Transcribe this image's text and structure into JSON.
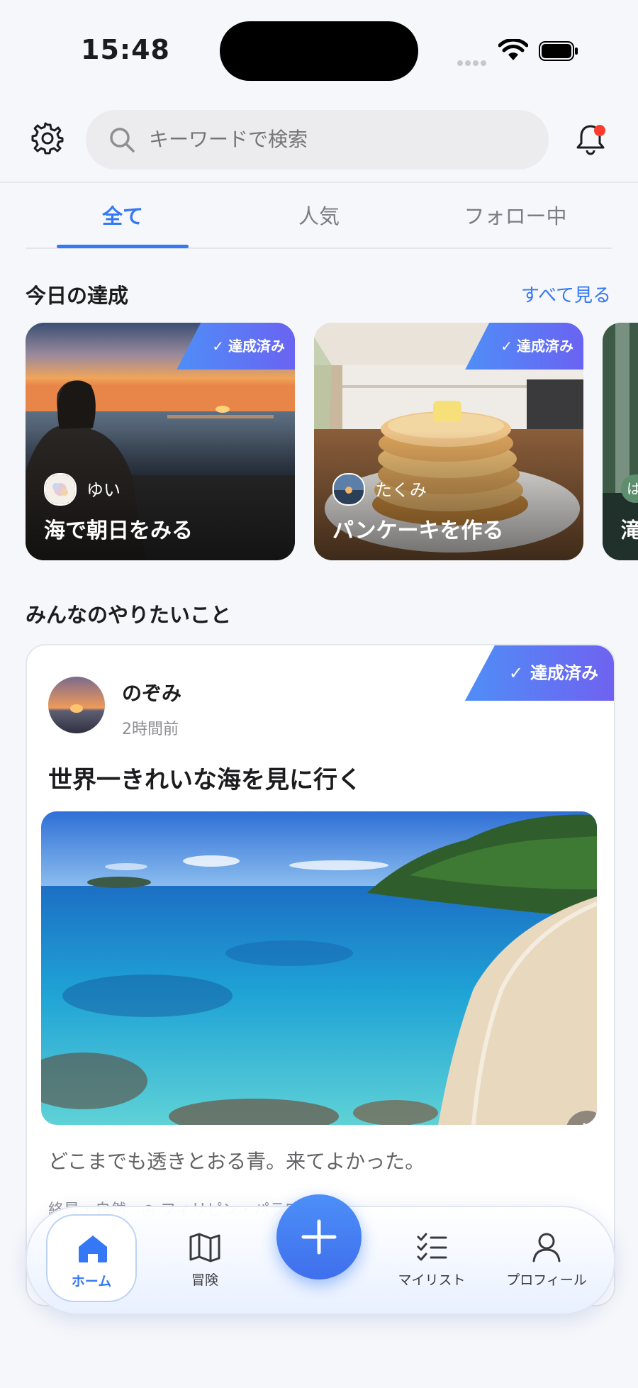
{
  "status_bar": {
    "time": "15:48"
  },
  "search": {
    "placeholder": "キーワードで検索"
  },
  "tabs": [
    {
      "label": "全て",
      "active": true
    },
    {
      "label": "人気",
      "active": false
    },
    {
      "label": "フォロー中",
      "active": false
    }
  ],
  "today": {
    "title": "今日の達成",
    "see_all": "すべて見る",
    "cards": [
      {
        "badge": "達成済み",
        "user": "ゆい",
        "title": "海で朝日をみる"
      },
      {
        "badge": "達成済み",
        "user": "たくみ",
        "title": "パンケーキを作る"
      },
      {
        "user": "は",
        "title": "滝"
      }
    ]
  },
  "feed": {
    "title": "みんなのやりたいこと",
    "post": {
      "badge": "達成済み",
      "user": "のぞみ",
      "time": "2時間前",
      "title": "世界一きれいな海を見に行く",
      "caption": "どこまでも透きとおる青。来てよかった。",
      "meta_partial": "終是・自然　◎ フィリピン・パラワン"
    }
  },
  "nav": {
    "items": [
      {
        "label": "ホーム",
        "icon": "home-icon",
        "active": true
      },
      {
        "label": "冒険",
        "icon": "map-icon",
        "active": false
      },
      {
        "label": "マイリスト",
        "icon": "checklist-icon",
        "active": false
      },
      {
        "label": "プロフィール",
        "icon": "person-icon",
        "active": false
      }
    ]
  },
  "colors": {
    "accent": "#3478f6",
    "badge_gradient_start": "#4f8ef7",
    "badge_gradient_end": "#6a63f2",
    "notification": "#ff3b30"
  }
}
